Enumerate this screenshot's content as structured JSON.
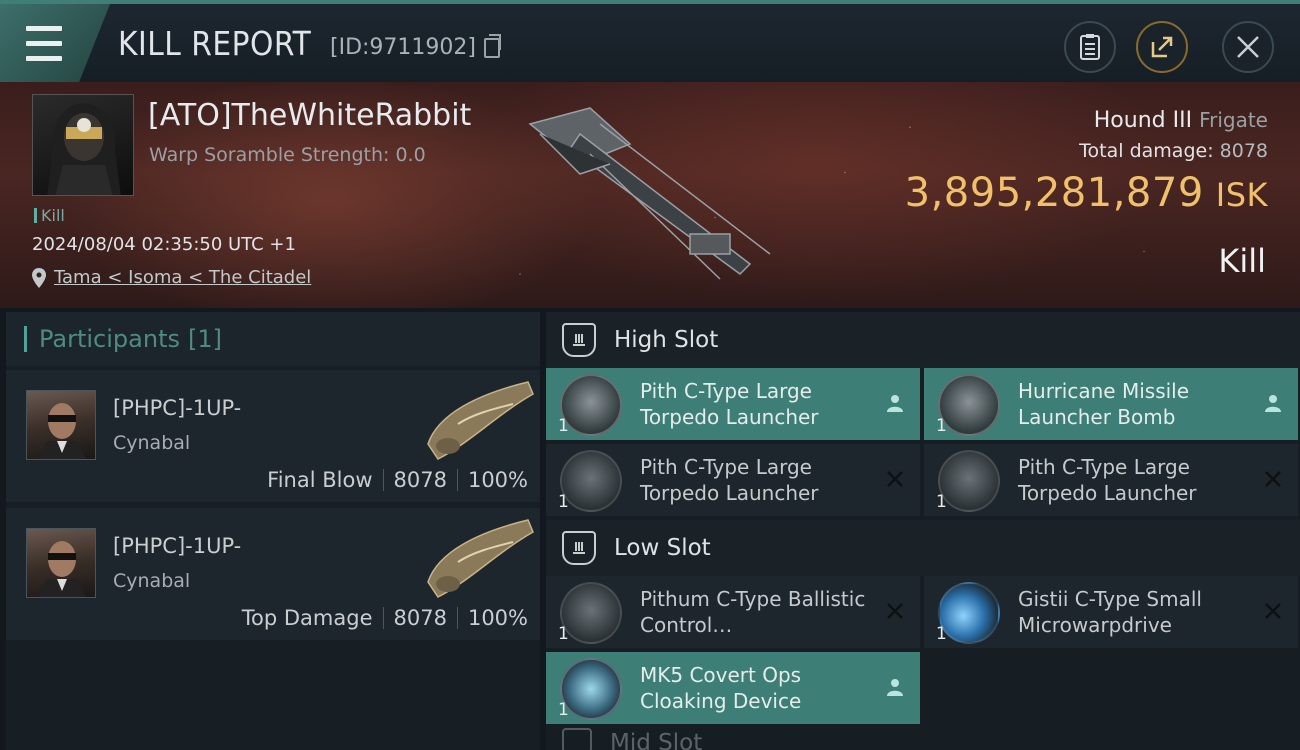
{
  "window": {
    "title": "KILL REPORT",
    "report_id": "[ID:9711902]"
  },
  "victim": {
    "pilot": "[ATO]TheWhiteRabbit",
    "scramble": "Warp Soramble Strength: 0.0",
    "tag": "Kill",
    "datetime": "2024/08/04 02:35:50 UTC +1",
    "location": "Tama < Isoma < The Citadel",
    "ship_name": "Hound III",
    "ship_class": "Frigate",
    "total_damage_label": "Total damage:",
    "total_damage": "8078",
    "isk_value": "3,895,281,879",
    "isk_unit": "ISK",
    "result": "Kill"
  },
  "participants": {
    "title": "Participants",
    "count": "[1]",
    "rows": [
      {
        "name": "[PHPC]-1UP-",
        "ship": "Cynabal",
        "role": "Final Blow",
        "damage": "8078",
        "percent": "100%"
      },
      {
        "name": "[PHPC]-1UP-",
        "ship": "Cynabal",
        "role": "Top Damage",
        "damage": "8078",
        "percent": "100%"
      }
    ]
  },
  "fitting": {
    "high_slot": {
      "label": "High Slot",
      "modules": [
        {
          "name": "Pith C-Type Large Torpedo Launcher",
          "qty": "1",
          "state": "dropped"
        },
        {
          "name": "Hurricane Missile Launcher Bomb",
          "qty": "1",
          "state": "dropped"
        },
        {
          "name": "Pith C-Type Large Torpedo Launcher",
          "qty": "1",
          "state": "destroyed"
        },
        {
          "name": "Pith C-Type Large Torpedo Launcher",
          "qty": "1",
          "state": "destroyed"
        }
      ]
    },
    "low_slot": {
      "label": "Low Slot",
      "modules": [
        {
          "name": "Pithum C-Type Ballistic Control…",
          "qty": "1",
          "state": "destroyed"
        },
        {
          "name": "Gistii C-Type Small Microwarpdrive",
          "qty": "1",
          "state": "destroyed"
        },
        {
          "name": "MK5 Covert Ops Cloaking Device",
          "qty": "1",
          "state": "dropped"
        }
      ]
    },
    "next_slot": {
      "label": "Mid Slot"
    }
  },
  "colors": {
    "accent": "#3d7f77",
    "isk": "#f0c06a",
    "background": "#12181d"
  }
}
